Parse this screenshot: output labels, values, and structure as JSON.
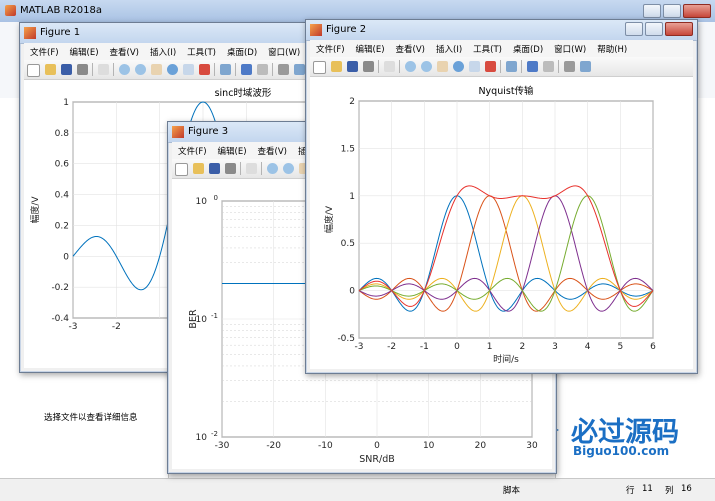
{
  "matlab": {
    "title": "MATLAB R2018a",
    "left_text": "选择文件以查看详细信息",
    "status": [
      "脚本",
      "行",
      "11",
      "列",
      "16"
    ]
  },
  "watermark": {
    "big": "必过源码",
    "small": "Biguo100.com"
  },
  "menus": {
    "full": [
      "文件(F)",
      "编辑(E)",
      "查看(V)",
      "插入(I)",
      "工具(T)",
      "桌面(D)",
      "窗口(W)",
      "帮助(H)"
    ],
    "fig1": [
      "文件(F)",
      "编辑(E)",
      "查看(V)",
      "插入(I)",
      "工具(T)",
      "桌面(D)",
      "窗口(W)",
      "帮"
    ],
    "fig3": [
      "文件(F)",
      "编辑(E)",
      "查看(V)",
      "插入"
    ]
  },
  "figures": {
    "fig1": {
      "title": "Figure 1"
    },
    "fig2": {
      "title": "Figure 2"
    },
    "fig3": {
      "title": "Figure 3"
    }
  },
  "chart_data": [
    {
      "id": "fig1",
      "type": "line",
      "title": "sinc时域波形",
      "ylabel": "幅度/V",
      "xlabel": "",
      "xlim": [
        -3,
        3
      ],
      "ylim": [
        -0.4,
        1
      ],
      "xticks": [
        -3,
        -2
      ],
      "yticks": [
        -0.4,
        -0.2,
        0,
        0.2,
        0.4,
        0.6,
        0.8,
        1
      ],
      "series": [
        {
          "function": "sinc",
          "color": "#0072bd"
        }
      ]
    },
    {
      "id": "fig2",
      "type": "line",
      "title": "Nyquist传输",
      "xlabel": "时间/s",
      "ylabel": "幅度/V",
      "xlim": [
        -3,
        6
      ],
      "ylim": [
        -0.5,
        2
      ],
      "xticks": [
        -3,
        -2,
        -1,
        0,
        1,
        2,
        3,
        4,
        5,
        6
      ],
      "yticks": [
        -0.5,
        0,
        0.5,
        1,
        1.5,
        2
      ],
      "series": [
        {
          "shift": 0,
          "color": "#0072bd"
        },
        {
          "shift": 1,
          "color": "#d95319"
        },
        {
          "shift": 2,
          "color": "#edb120"
        },
        {
          "shift": 3,
          "color": "#7e2f8e"
        },
        {
          "shift": 4,
          "color": "#77ac30"
        },
        {
          "sum": true,
          "color": "#e8322c"
        }
      ]
    },
    {
      "id": "fig3",
      "type": "line",
      "title": "",
      "xlabel": "SNR/dB",
      "ylabel": "BER",
      "xscale": "linear",
      "yscale": "log",
      "xlim": [
        -30,
        30
      ],
      "ylim": [
        0.01,
        1
      ],
      "xticks": [
        -30,
        -20,
        -10,
        0,
        10,
        20,
        30
      ],
      "ytick_labels": [
        "10^0",
        "10^-1",
        "10^-2"
      ],
      "series": [
        {
          "x": [
            -30,
            30
          ],
          "y": [
            0.2,
            0.2
          ],
          "color": "#0072bd"
        }
      ]
    }
  ]
}
